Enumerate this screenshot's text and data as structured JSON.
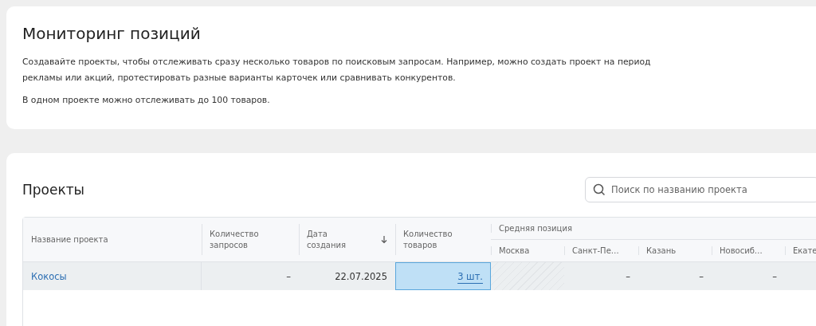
{
  "intro": {
    "title": "Мониторинг позиций",
    "paragraphs": [
      "Создавайте проекты, чтобы отслеживать сразу несколько товаров по поисковым запросам. Например, можно создать проект на период рекламы или акций, протестировать разные варианты карточек или сравнивать конкурентов.",
      "В одном проекте можно отслеживать до 100 товаров."
    ]
  },
  "projects": {
    "title": "Проекты",
    "search": {
      "placeholder": "Поиск по названию проекта"
    },
    "columns": [
      {
        "label": "Название проекта",
        "sorted": false
      },
      {
        "label": "Количество запросов",
        "sorted": false
      },
      {
        "label": "Дата создания",
        "sorted": true
      },
      {
        "label": "Количество товаров",
        "sorted": false
      }
    ],
    "group": {
      "label": "Средняя позиция",
      "cities": [
        "Москва",
        "Санкт-Пе…",
        "Казань",
        "Новосиб…",
        "Екате"
      ]
    },
    "rows": [
      {
        "name": "Кокосы",
        "queries": "–",
        "date": "22.07.2025",
        "count": "3 шт.",
        "count_selected": true,
        "positions": [
          {
            "kind": "hatched"
          },
          {
            "kind": "value",
            "text": "–"
          },
          {
            "kind": "value",
            "text": "–"
          },
          {
            "kind": "value",
            "text": "–"
          }
        ]
      }
    ]
  }
}
